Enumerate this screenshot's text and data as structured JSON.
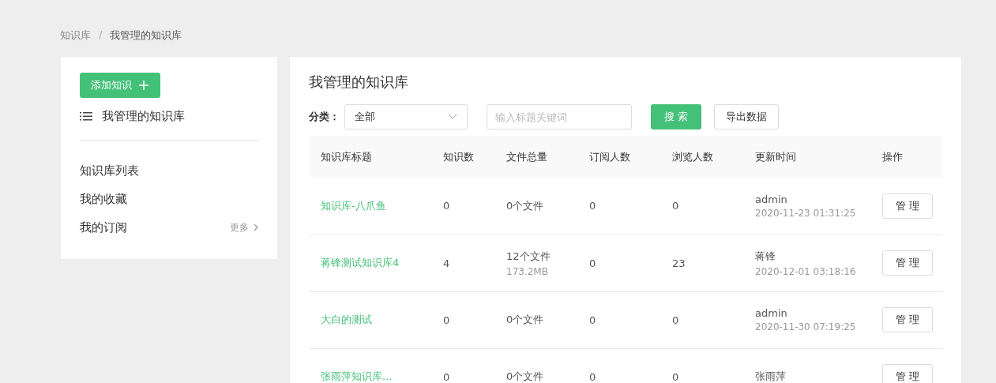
{
  "breadcrumb": [
    {
      "label": "知识库",
      "selected": false
    },
    {
      "label": "我管理的知识库",
      "selected": true
    }
  ],
  "breadcrumb_separator": "/",
  "sidebar": {
    "add_button": "添加知识",
    "section_title": "我管理的知识库",
    "items": [
      {
        "label": "知识库列表"
      },
      {
        "label": "我的收藏"
      },
      {
        "label": "我的订阅",
        "more": "更多"
      }
    ]
  },
  "main": {
    "title": "我管理的知识库",
    "filter": {
      "label": "分类：",
      "category": "全部",
      "search_placeholder": "输入标题关键词",
      "search_button": "搜 索",
      "export_button": "导出数据"
    },
    "table": {
      "columns": [
        "知识库标题",
        "知识数",
        "文件总量",
        "订阅人数",
        "浏览人数",
        "更新时间",
        "操作"
      ],
      "rows": [
        {
          "title": "知识库-八爪鱼",
          "count": "0",
          "files": "0个文件",
          "size": "",
          "subscribers": "0",
          "views": "0",
          "user": "admin",
          "time": "2020-11-23 01:31:25",
          "action": "管 理"
        },
        {
          "title": "蒋锋测试知识库4",
          "count": "4",
          "files": "12个文件",
          "size": "173.2MB",
          "subscribers": "0",
          "views": "23",
          "user": "蒋锋",
          "time": "2020-12-01 03:18:16",
          "action": "管 理"
        },
        {
          "title": "大白的测试",
          "count": "0",
          "files": "0个文件",
          "size": "",
          "subscribers": "0",
          "views": "0",
          "user": "admin",
          "time": "2020-11-30 07:19:25",
          "action": "管 理"
        },
        {
          "title": "张雨萍知识库...",
          "count": "0",
          "files": "0个文件",
          "size": "",
          "subscribers": "0",
          "views": "0",
          "user": "张雨萍",
          "time": "",
          "action": "管 理"
        }
      ]
    }
  }
}
